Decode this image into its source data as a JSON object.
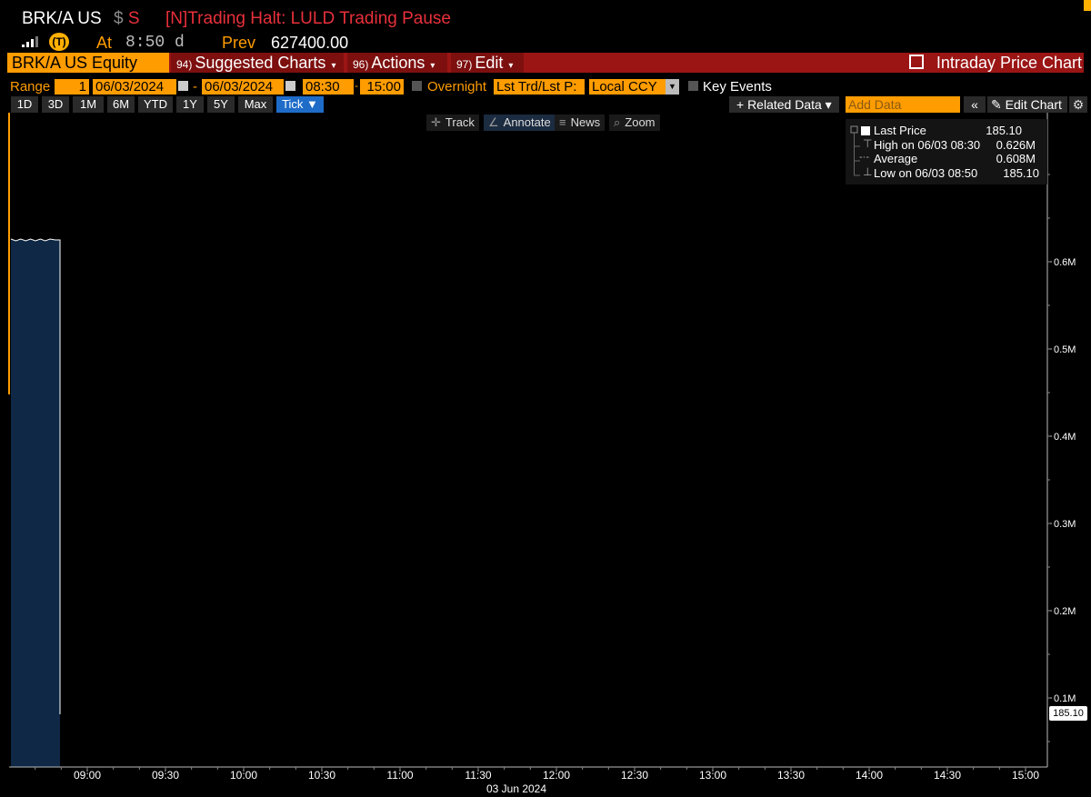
{
  "header": {
    "ticker": "BRK/A US",
    "currency_symbol": "$",
    "status_code": "S",
    "halt_message": "[N]Trading Halt: LULD Trading Pause",
    "at_label": "At",
    "at_value": "8:50 d",
    "prev_label": "Prev",
    "prev_value": "627400.00",
    "badge_icon": "signal-badge-icon"
  },
  "toolbar": {
    "security": "BRK/A US Equity",
    "suggested": {
      "num": "94)",
      "label": "Suggested Charts"
    },
    "actions": {
      "num": "96)",
      "label": "Actions"
    },
    "edit": {
      "num": "97)",
      "label": "Edit"
    },
    "title": "Intraday Price Chart"
  },
  "range_row": {
    "range_label": "Range",
    "range_value": "1",
    "start_date": "06/03/2024",
    "dash": "-",
    "end_date": "06/03/2024",
    "start_time": "08:30",
    "end_time": "15:00",
    "overnight_label": "Overnight",
    "price_type": "Lst Trd/Lst P:",
    "currency": "Local CCY",
    "key_events_label": "Key Events"
  },
  "periods": [
    "1D",
    "3D",
    "1M",
    "6M",
    "YTD",
    "1Y",
    "5Y",
    "Max",
    "Tick ▼"
  ],
  "controls": {
    "related_data": "+ Related Data ▾",
    "add_data_placeholder": "Add Data",
    "collapse": "«",
    "edit_chart": "✎ Edit Chart",
    "settings_icon": "gear-icon"
  },
  "chart_tools": [
    {
      "icon": "✛",
      "label": "Track"
    },
    {
      "icon": "∠",
      "label": "Annotate"
    },
    {
      "icon": "≡",
      "label": "News"
    },
    {
      "icon": "⌕",
      "label": "Zoom"
    }
  ],
  "legend": {
    "last_price_label": "Last Price",
    "last_price_value": "185.10",
    "high_label": "High on 06/03 08:30",
    "high_value": "0.626M",
    "average_label": "Average",
    "average_value": "0.608M",
    "low_label": "Low on 06/03 08:50",
    "low_value": "185.10"
  },
  "colors": {
    "accent_orange": "#ff9c00",
    "toolbar_red": "#9b1515",
    "halt_red": "#e8303b",
    "area_fill": "#0e2846"
  },
  "chart_data": {
    "type": "area",
    "title": "",
    "xlabel": "03 Jun 2024",
    "ylabel": "",
    "x_ticks": [
      "09:00",
      "09:30",
      "10:00",
      "10:30",
      "11:00",
      "11:30",
      "12:00",
      "12:30",
      "13:00",
      "13:30",
      "14:00",
      "14:30",
      "15:00"
    ],
    "y_ticks": [
      "0.1M",
      "0.2M",
      "0.3M",
      "0.4M",
      "0.5M",
      "0.6M"
    ],
    "x_range": [
      "08:30",
      "15:05"
    ],
    "ylim": [
      0,
      0.65
    ],
    "y_unit": "M",
    "last_price_label": "185.10",
    "series": [
      {
        "x": [
          "08:30",
          "08:32",
          "08:34",
          "08:36",
          "08:38",
          "08:40",
          "08:42",
          "08:44",
          "08:46",
          "08:48",
          "08:50",
          "08:50"
        ],
        "values": [
          0.626,
          0.625,
          0.626,
          0.625,
          0.626,
          0.625,
          0.626,
          0.625,
          0.626,
          0.626,
          0.625,
          0.000185
        ]
      }
    ],
    "grid": false,
    "legend_position": "top-right"
  }
}
